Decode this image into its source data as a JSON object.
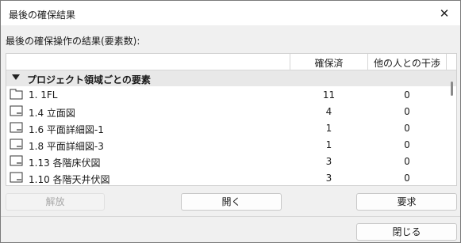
{
  "window": {
    "title": "最後の確保結果",
    "close_glyph": "✕"
  },
  "subtitle": "最後の確保操作の結果(要素数):",
  "table": {
    "columns": [
      "確保済",
      "他の人との干渉"
    ],
    "group_label": "プロジェクト領域ごとの要素",
    "rows": [
      {
        "icon": "floor-plan-icon",
        "name": "1. 1FL",
        "reserved": "11",
        "conflicts": "0"
      },
      {
        "icon": "elevation-view-icon",
        "name": "1.4 立面図",
        "reserved": "4",
        "conflicts": "0"
      },
      {
        "icon": "detail-view-icon",
        "name": "1.6 平面詳細図-1",
        "reserved": "1",
        "conflicts": "0"
      },
      {
        "icon": "detail-view-icon",
        "name": "1.8 平面詳細図-3",
        "reserved": "1",
        "conflicts": "0"
      },
      {
        "icon": "floor-finish-view-icon",
        "name": "1.13 各階床伏図",
        "reserved": "3",
        "conflicts": "0"
      },
      {
        "icon": "ceiling-view-icon",
        "name": "1.10 各階天井伏図",
        "reserved": "3",
        "conflicts": "0"
      }
    ]
  },
  "buttons": {
    "release": "解放",
    "open": "開く",
    "request": "要求",
    "close": "閉じる"
  }
}
